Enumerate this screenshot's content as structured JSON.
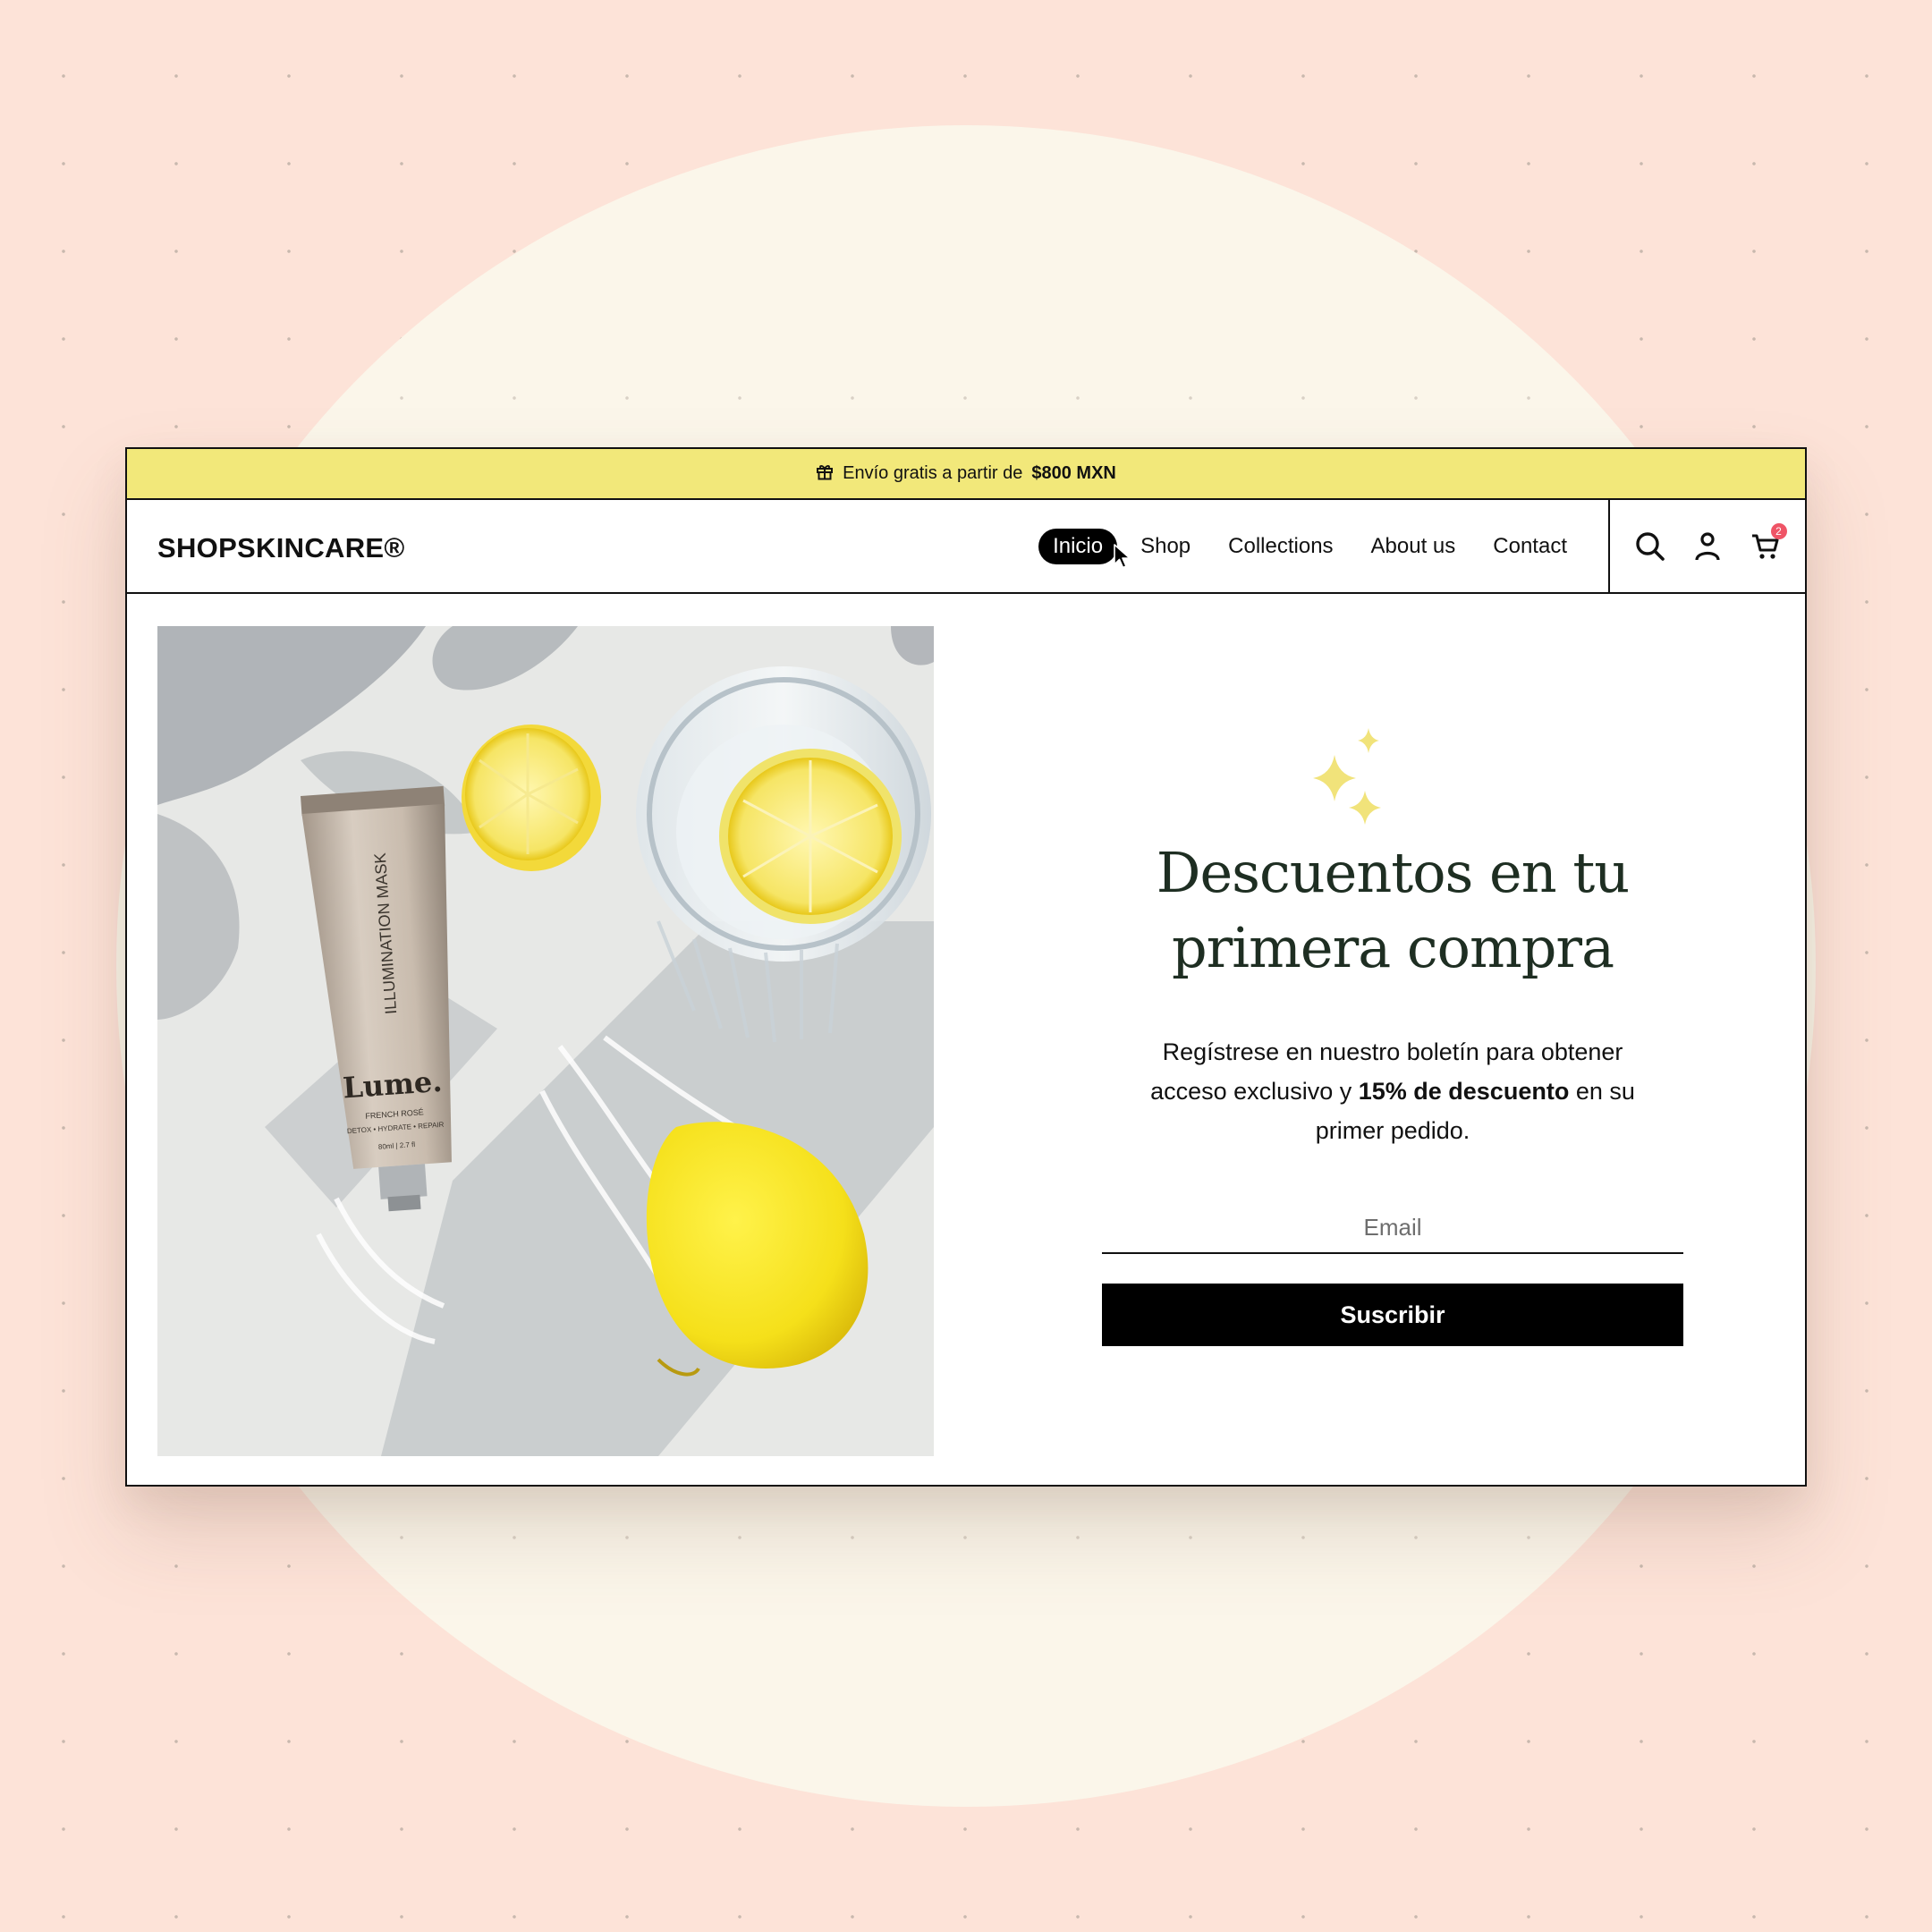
{
  "announcement": {
    "icon": "gift-icon",
    "text": "Envío gratis a partir de",
    "highlight": "$800 MXN"
  },
  "header": {
    "logo": "SHOPSKINCARE®",
    "nav": [
      {
        "label": "Inicio",
        "active": true
      },
      {
        "label": "Shop"
      },
      {
        "label": "Collections"
      },
      {
        "label": "About us"
      },
      {
        "label": "Contact"
      }
    ],
    "icons": [
      "search-icon",
      "account-icon",
      "cart-icon"
    ],
    "cart_count": "2"
  },
  "hero_image": {
    "product_name": "ILLUMINATION MASK",
    "brand": "Lume.",
    "variant": "FRENCH ROSÉ",
    "tagline": "DETOX • HYDRATE • REPAIR",
    "size": "80ml | 2.7 fl"
  },
  "promo": {
    "sparkle_icon": "sparkle-icon",
    "title_line1": "Descuentos en tu",
    "title_line2": "primera compra",
    "body_before": "Regístrese en nuestro boletín para obtener acceso exclusivo y",
    "body_bold": "15% de descuento",
    "body_after": "en su primer pedido.",
    "email_placeholder": "Email",
    "button_label": "Suscribir"
  },
  "colors": {
    "page_background": "#fde3d8",
    "halo": "#fbf6ea",
    "announcement_bar": "#f2e87a",
    "heading": "#1e2e22",
    "sparkle": "#f1e37a",
    "badge": "#ef5466"
  }
}
